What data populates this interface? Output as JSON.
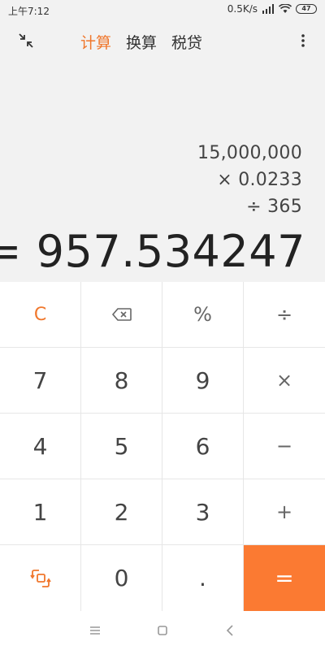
{
  "status_bar": {
    "time": "上午7:12",
    "network_speed": "0.5K/s",
    "battery": "47"
  },
  "tabs": [
    {
      "label": "计算",
      "active": true
    },
    {
      "label": "换算",
      "active": false
    },
    {
      "label": "税贷",
      "active": false
    }
  ],
  "display": {
    "expression_lines": [
      "15,000,000",
      "×   0.0233",
      "÷   365"
    ],
    "result": "= 957.534247"
  },
  "keypad": {
    "rows": [
      [
        "C",
        "",
        "%",
        "÷"
      ],
      [
        "7",
        "8",
        "9",
        "×"
      ],
      [
        "4",
        "5",
        "6",
        "−"
      ],
      [
        "1",
        "2",
        "3",
        "+"
      ],
      [
        "",
        "0",
        ".",
        "="
      ]
    ]
  },
  "icons": {
    "collapse": "collapse-arrows-icon",
    "more": "more-vertical-icon",
    "backspace": "backspace-icon",
    "switch_mode": "switch-mode-icon",
    "nav_menu": "menu-icon",
    "nav_home": "home-icon",
    "nav_back": "back-icon"
  },
  "colors": {
    "accent": "#f0772c",
    "equals_bg": "#fb7a32",
    "display_bg": "#f2f2f2"
  }
}
